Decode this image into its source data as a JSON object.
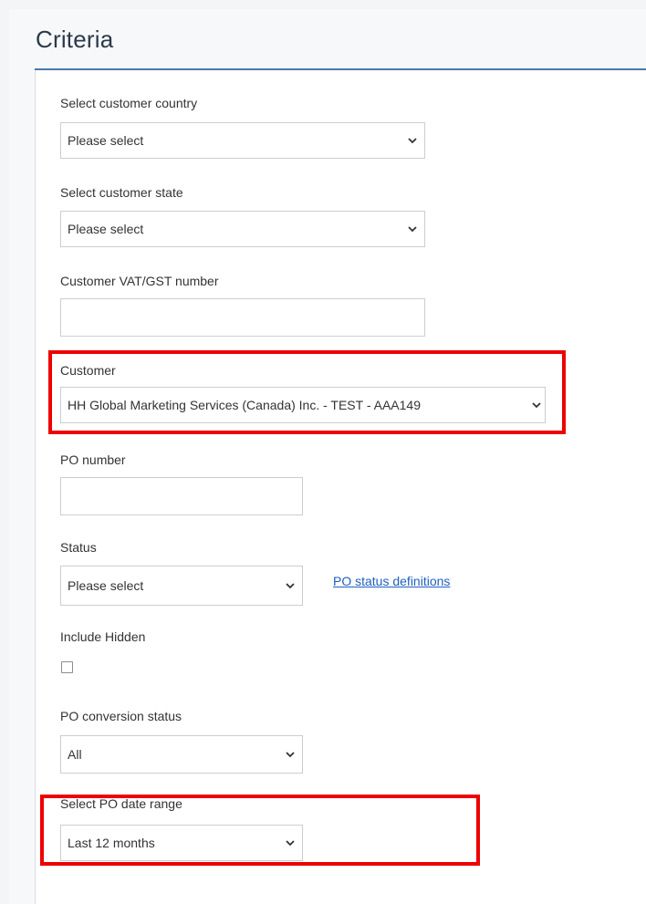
{
  "section": {
    "title": "Criteria"
  },
  "fields": {
    "country": {
      "label": "Select customer country",
      "value": "Please select"
    },
    "state": {
      "label": "Select customer state",
      "value": "Please select"
    },
    "vat": {
      "label": "Customer VAT/GST number",
      "value": ""
    },
    "customer": {
      "label": "Customer",
      "value": "HH Global Marketing Services (Canada) Inc. - TEST - AAA149"
    },
    "po_number": {
      "label": "PO number",
      "value": ""
    },
    "status": {
      "label": "Status",
      "value": "Please select",
      "link": "PO status definitions"
    },
    "include_hidden": {
      "label": "Include Hidden",
      "checked": false
    },
    "conversion": {
      "label": "PO conversion status",
      "value": "All"
    },
    "date_range": {
      "label": "Select PO date range",
      "value": "Last 12 months"
    }
  },
  "highlight_color": "#ee0000",
  "icons": {
    "dropdown": "chevron-down-icon"
  }
}
